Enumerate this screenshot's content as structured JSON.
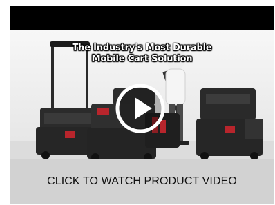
{
  "video": {
    "overlay_title_line1": "The Industry's Most Durable",
    "overlay_title_line2": "Mobile Cart Solution",
    "caption": "CLICK TO WATCH PRODUCT VIDEO",
    "play_icon": "play-icon"
  },
  "colors": {
    "top_bar": "#000000",
    "caption_bar": "#d2d2d2",
    "caption_text": "#111111",
    "play_button": "#ffffff"
  }
}
